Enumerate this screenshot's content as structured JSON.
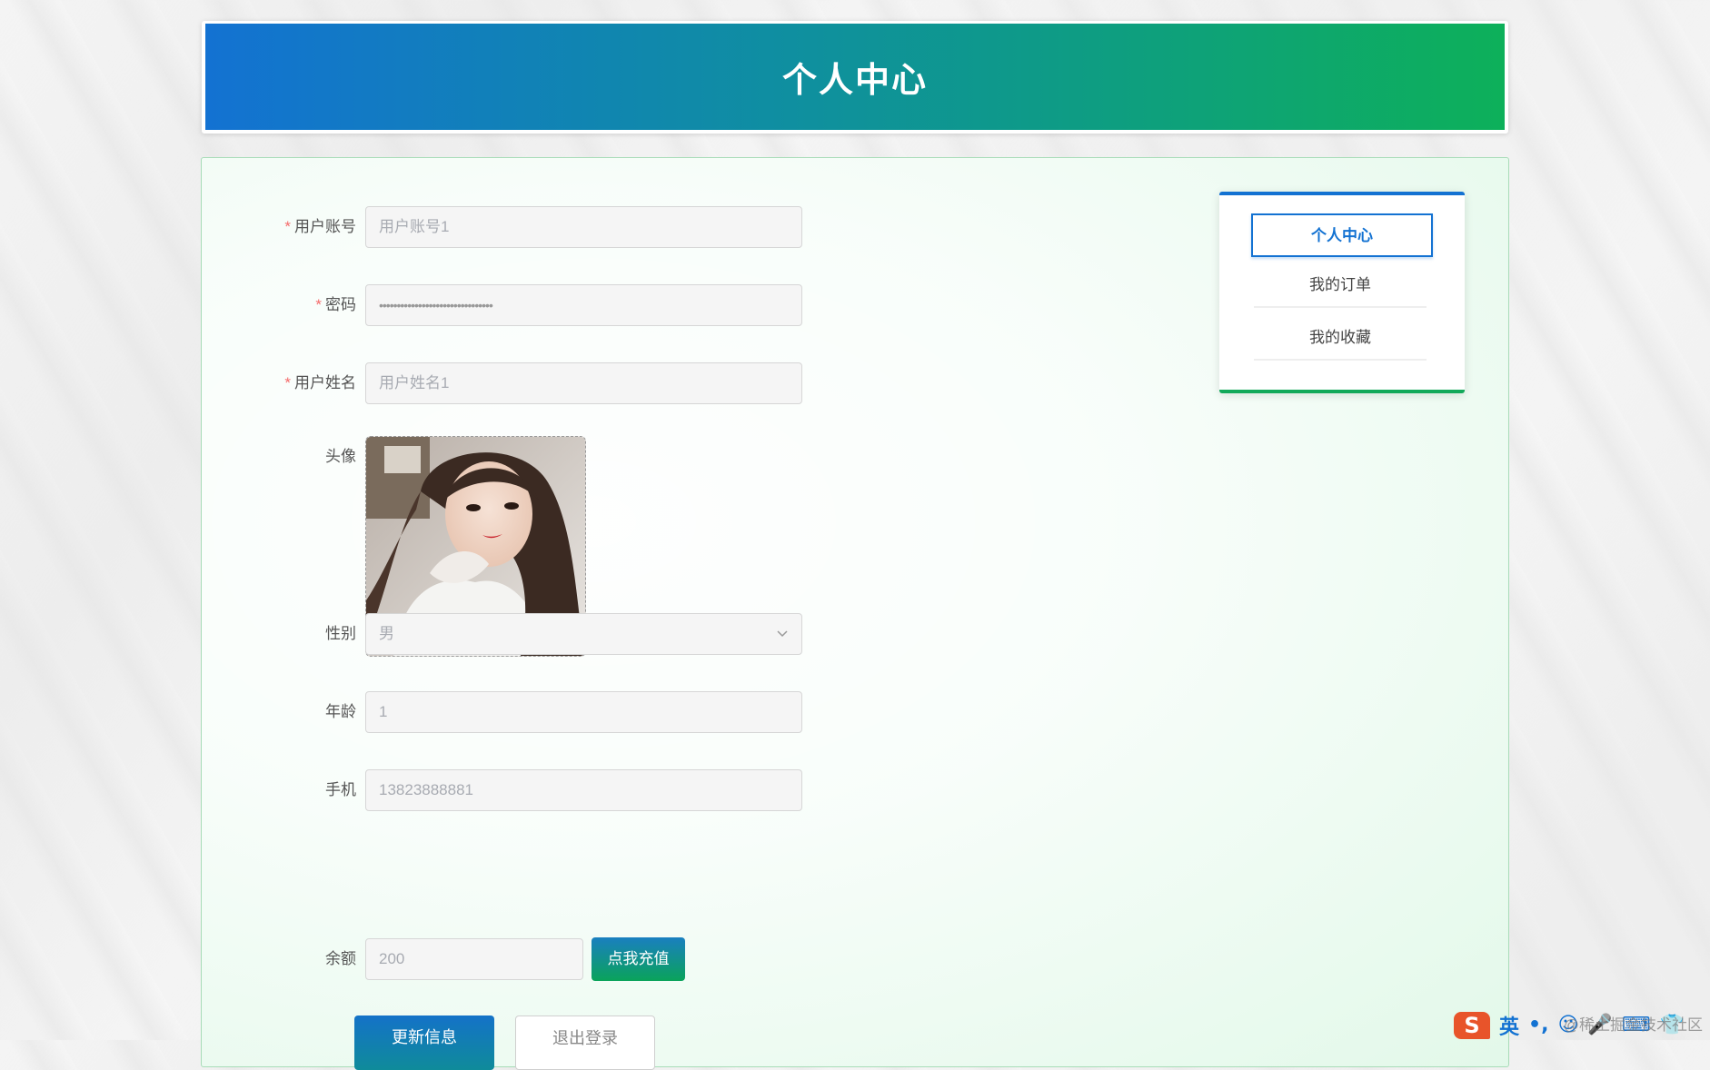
{
  "header": {
    "title": "个人中心"
  },
  "form": {
    "account": {
      "label": "用户账号",
      "value": "用户账号1"
    },
    "password": {
      "label": "密码",
      "value": "••••••••••••••••••••••••••••••••"
    },
    "name": {
      "label": "用户姓名",
      "value": "用户姓名1"
    },
    "avatar": {
      "label": "头像"
    },
    "gender": {
      "label": "性别",
      "value": "男"
    },
    "age": {
      "label": "年龄",
      "value": "1"
    },
    "phone": {
      "label": "手机",
      "value": "13823888881"
    },
    "balance": {
      "label": "余额",
      "value": "200",
      "recharge_label": "点我充值"
    },
    "required_mark": "*",
    "update_label": "更新信息",
    "logout_label": "退出登录"
  },
  "menu": {
    "items": [
      {
        "label": "个人中心",
        "active": true
      },
      {
        "label": "我的订单",
        "active": false
      },
      {
        "label": "我的收藏",
        "active": false
      }
    ]
  },
  "ime": {
    "lang": "英",
    "watermark": "@稀土掘金技术社区"
  },
  "colors": {
    "primary": "#1372d2",
    "accent": "#0db05a",
    "required": "#f56c6c"
  }
}
